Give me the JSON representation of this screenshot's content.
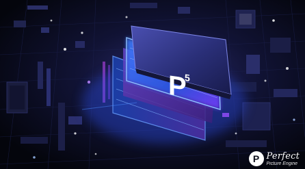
{
  "chip": {
    "logo_letter": "P",
    "logo_superscript": "5"
  },
  "watermark": {
    "badge_letter": "P",
    "brand": "Perfect",
    "tagline": "Picture Engine"
  },
  "colors": {
    "background": "#05060f",
    "glow_blue": "#2f6bff",
    "glow_purple": "#8a4dff",
    "chip_top": "#2a2f6e",
    "accent_magenta": "#d04bff"
  }
}
